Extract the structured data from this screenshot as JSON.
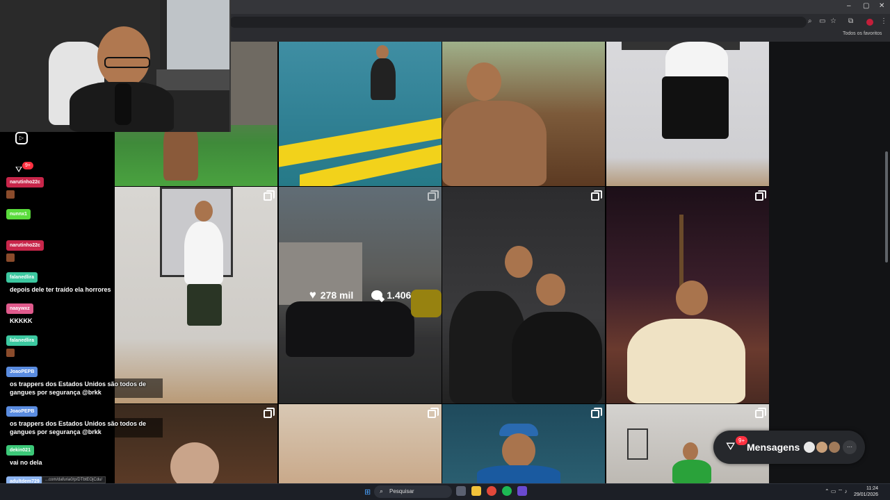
{
  "browser": {
    "window_controls": [
      "–",
      "▢",
      "✕"
    ],
    "bookmarks_label": "Todos os favoritos",
    "status_url": "...com/dafuria0/p/DTbtEOjCdu/"
  },
  "grid": {
    "hover_likes": "278 mil",
    "hover_comments": "1.406"
  },
  "chat": {
    "messages": [
      {
        "user": "narutinho22c",
        "text": "",
        "color": "#c8264a"
      },
      {
        "user": "nunnx1",
        "text": "",
        "color": "#5adc3c"
      },
      {
        "user": "narutinho22c",
        "text": "",
        "color": "#c8264a"
      },
      {
        "user": "falanedlira",
        "text": "depois dele ter traído ela horrores",
        "color": "#3cc8a0"
      },
      {
        "user": "naaywxz",
        "text": "KKKKK",
        "color": "#e05a8c"
      },
      {
        "user": "falanedlira",
        "text": "",
        "color": "#3cc8a0"
      },
      {
        "user": "JoaoPEPB",
        "text": "os trappers dos Estados Unidos são todos de gangues por segurança @brkk",
        "color": "#5a8ce0"
      },
      {
        "user": "JoaoPEPB",
        "text": "os trappers dos Estados Unidos são todos de gangues por segurança @brkk",
        "color": "#5a8ce0"
      },
      {
        "user": "dekin021",
        "text": "vai no dela",
        "color": "#3cc878"
      },
      {
        "user": "adultdem729",
        "text": "",
        "color": "#8cb4f0"
      }
    ],
    "notification_badge": "9+"
  },
  "messages_pill": {
    "label": "Mensagens",
    "badge": "9+",
    "more": "···"
  },
  "taskbar": {
    "search_placeholder": "Pesquisar",
    "time": "11:24",
    "date": "29/01/2026"
  },
  "colors": {
    "ig_badge": "#ff3040",
    "page_bg": "#000000"
  }
}
